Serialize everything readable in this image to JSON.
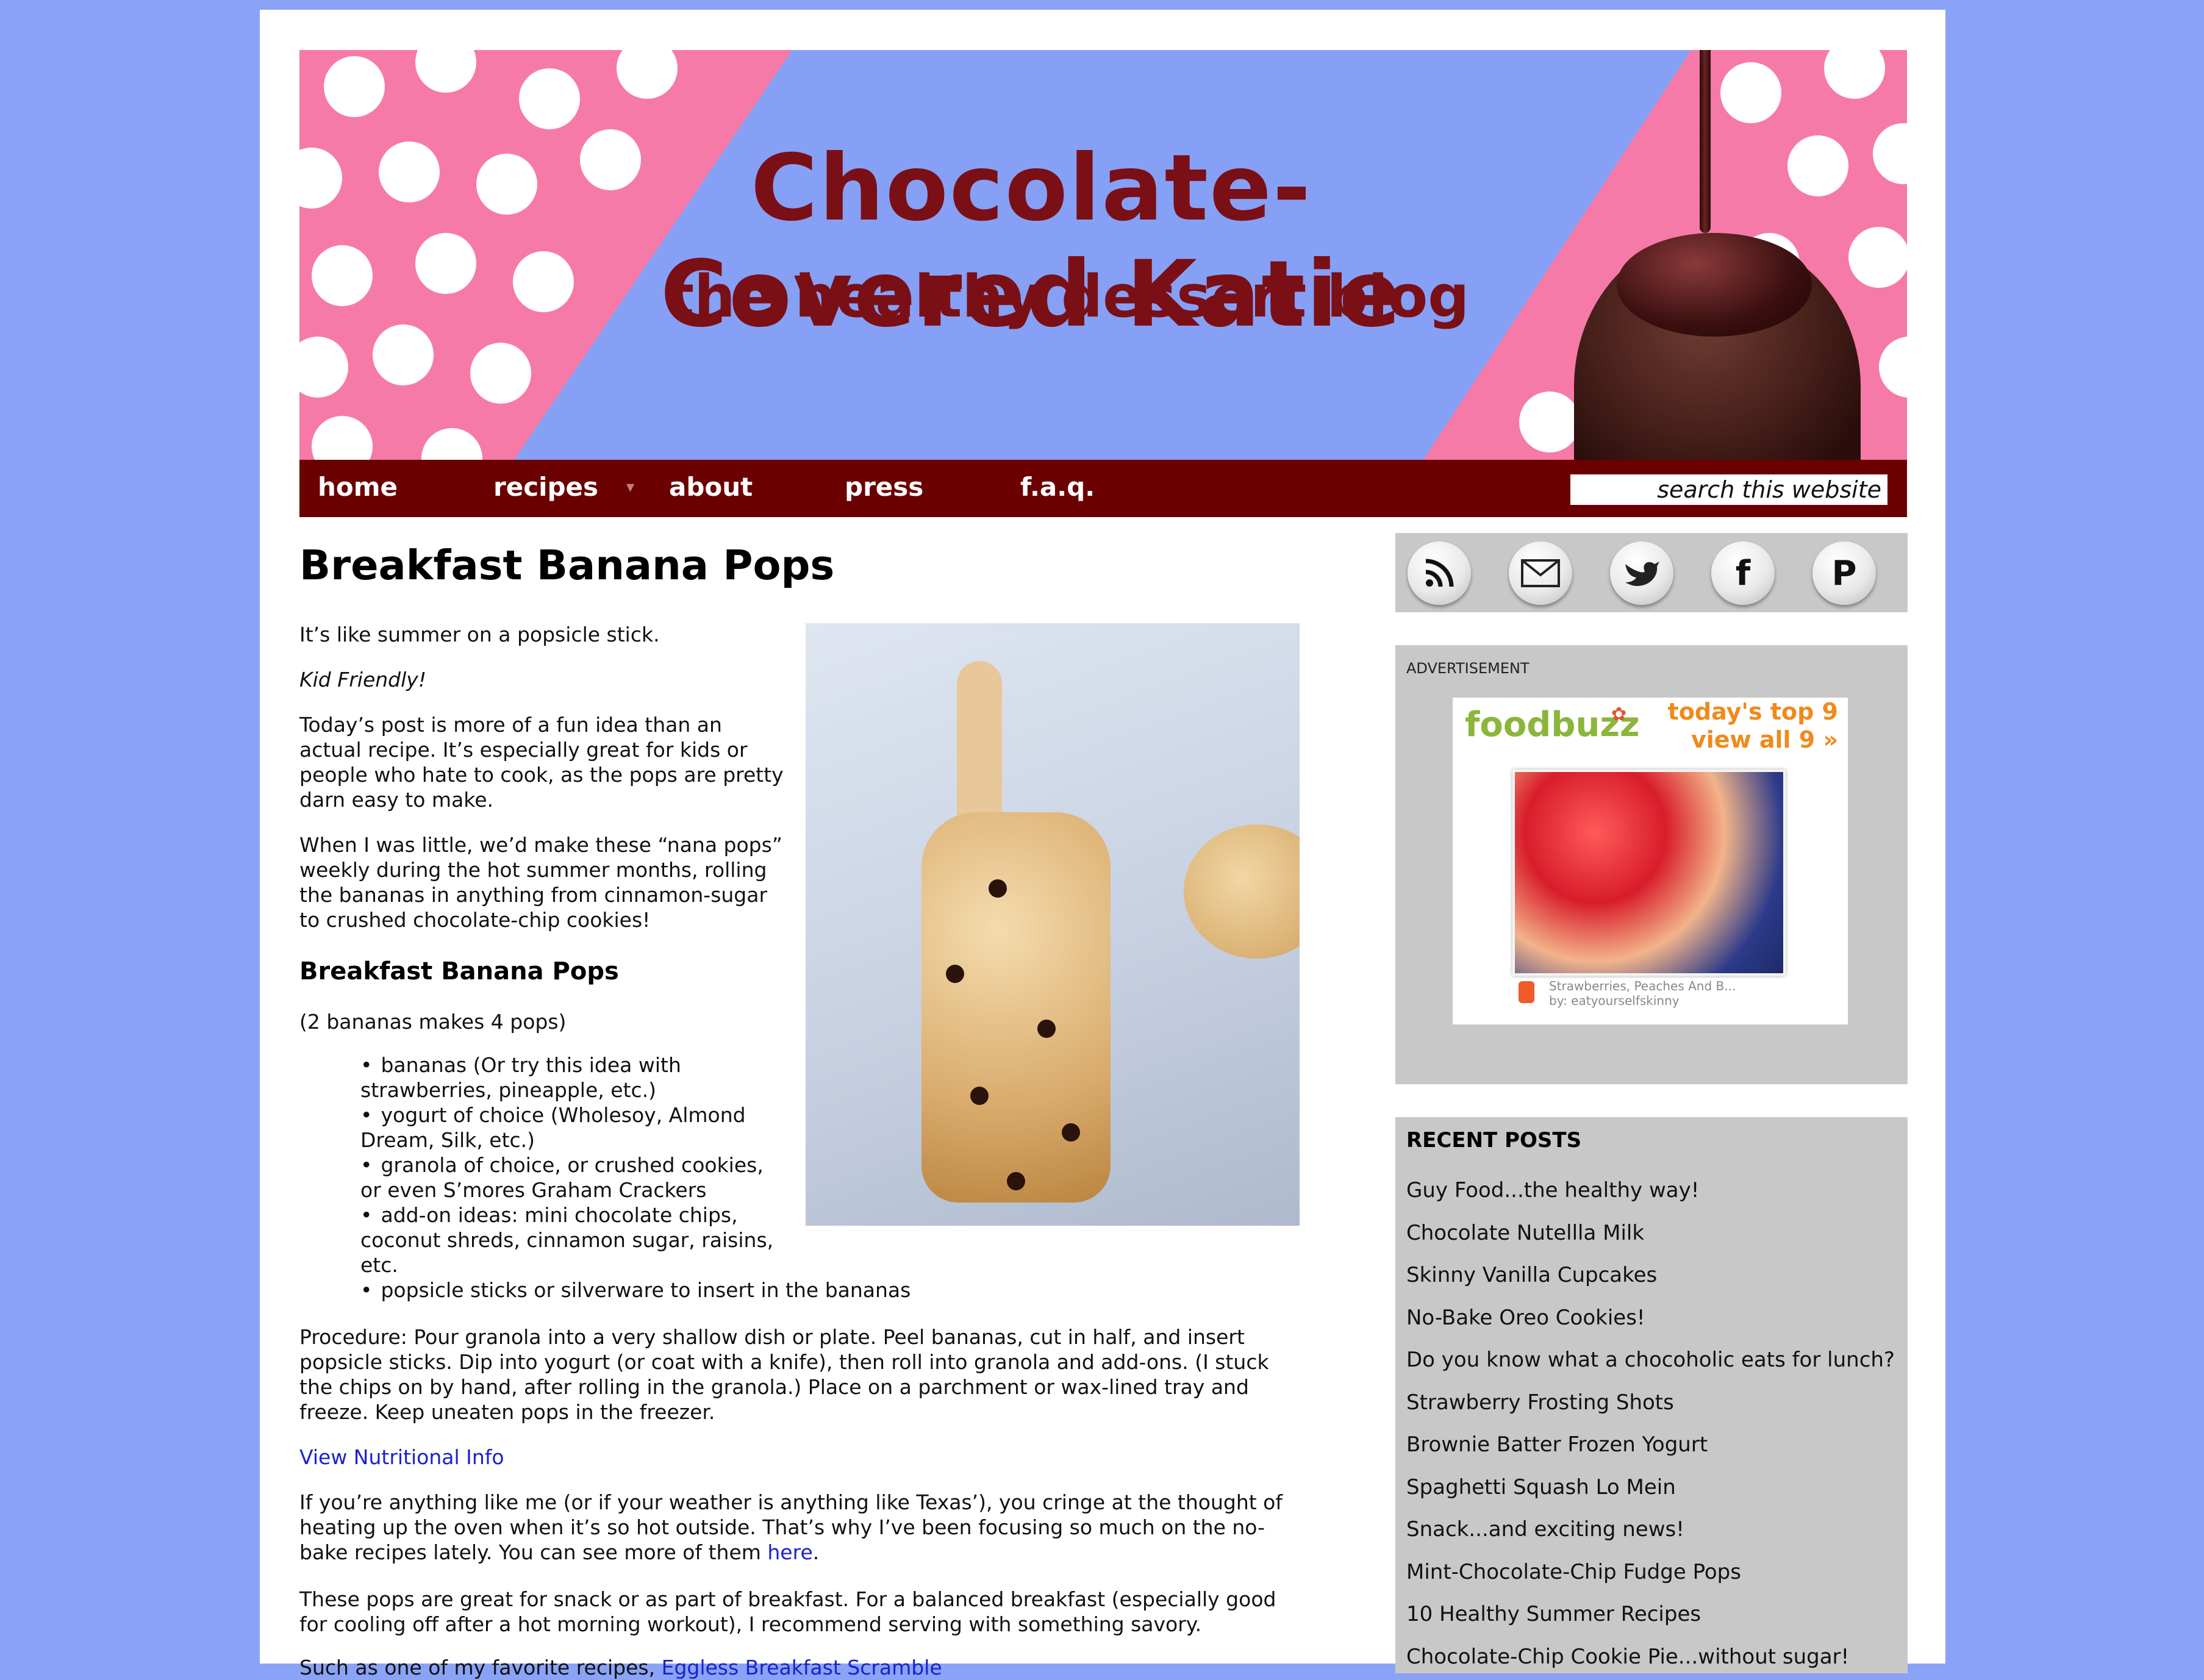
{
  "header": {
    "title": "Chocolate-Covered Katie",
    "subtitle": "the healthy dessert blog"
  },
  "nav": {
    "items": [
      "home",
      "recipes",
      "about",
      "press",
      "f.a.q."
    ],
    "search_placeholder": "search this website"
  },
  "post": {
    "title": "Breakfast Banana Pops",
    "intro": "It’s like summer on a popsicle stick.",
    "tag": "Kid Friendly!",
    "para1": "Today’s post is more of a fun idea than an actual recipe. It’s especially great for kids or people who hate to cook, as the pops are pretty darn easy to make.",
    "para2": "When I was little, we’d make these “nana pops” weekly during the hot summer months, rolling the bananas in anything from cinnamon-sugar to crushed chocolate-chip cookies!",
    "recipe_title": "Breakfast Banana Pops",
    "yield": "(2 bananas makes 4 pops)",
    "ingredients": [
      "bananas (Or try this idea with strawberries, pineapple, etc.)",
      "yogurt of choice (Wholesoy, Almond Dream, Silk, etc.)",
      "granola of choice, or crushed cookies, or even S’mores Graham Crackers",
      "add-on ideas: mini chocolate chips, coconut shreds, cinnamon sugar, raisins, etc.",
      "popsicle sticks or silverware to insert in the bananas"
    ],
    "procedure": "Procedure: Pour granola into a very shallow dish or plate. Peel bananas, cut in half, and insert popsicle sticks. Dip into yogurt (or coat with a knife), then roll into granola and add-ons. (I stuck the chips on by hand, after rolling in the granola.) Place on a parchment or wax-lined tray and freeze. Keep uneaten pops in the freezer.",
    "nutrition_link": "View Nutritional Info",
    "para3_text": "If you’re anything like me (or if your weather is anything like Texas’), you cringe at the thought of heating up the oven when it’s so hot outside. That’s why I’ve been focusing so much on the no-bake recipes lately. You can see more of them ",
    "para3_link": "here",
    "para3_end": ".",
    "para4": "These pops are great for snack or as part of breakfast. For a balanced breakfast (especially good for cooling off after a hot morning workout), I recommend serving with something savory.",
    "para5_text": "Such as one of my favorite recipes, ",
    "para5_link": "Eggless Breakfast Scramble"
  },
  "sidebar": {
    "social_icons": [
      "rss-icon",
      "email-icon",
      "twitter-icon",
      "facebook-icon",
      "pinterest-icon"
    ],
    "ad_label": "ADVERTISEMENT",
    "ad": {
      "brand": "foodbuzz",
      "top_line1": "today's top 9",
      "top_line2": "view all 9 »",
      "caption1": "Strawberries, Peaches And B...",
      "caption2": "by: eatyourselfskinny"
    },
    "recent_title": "RECENT POSTS",
    "recent_posts": [
      "Guy Food...the healthy way!",
      "Chocolate Nutellla Milk",
      "Skinny Vanilla Cupcakes",
      "No-Bake Oreo Cookies!",
      "Do you know what a chocoholic eats for lunch?",
      "Strawberry Frosting Shots",
      "Brownie Batter Frozen Yogurt",
      "Spaghetti Squash Lo Mein",
      "Snack...and exciting news!",
      "Mint-Chocolate-Chip Fudge Pops",
      "10 Healthy Summer Recipes",
      "Chocolate-Chip Cookie Pie...without sugar!"
    ]
  },
  "colors": {
    "background": "#8aa3f7",
    "nav": "#6b0000",
    "banner_pink": "#f67aa8",
    "banner_blue": "#86a0f5",
    "title": "#7a0f16",
    "link": "#1a22cc",
    "sidebar": "#c8c8c8"
  }
}
